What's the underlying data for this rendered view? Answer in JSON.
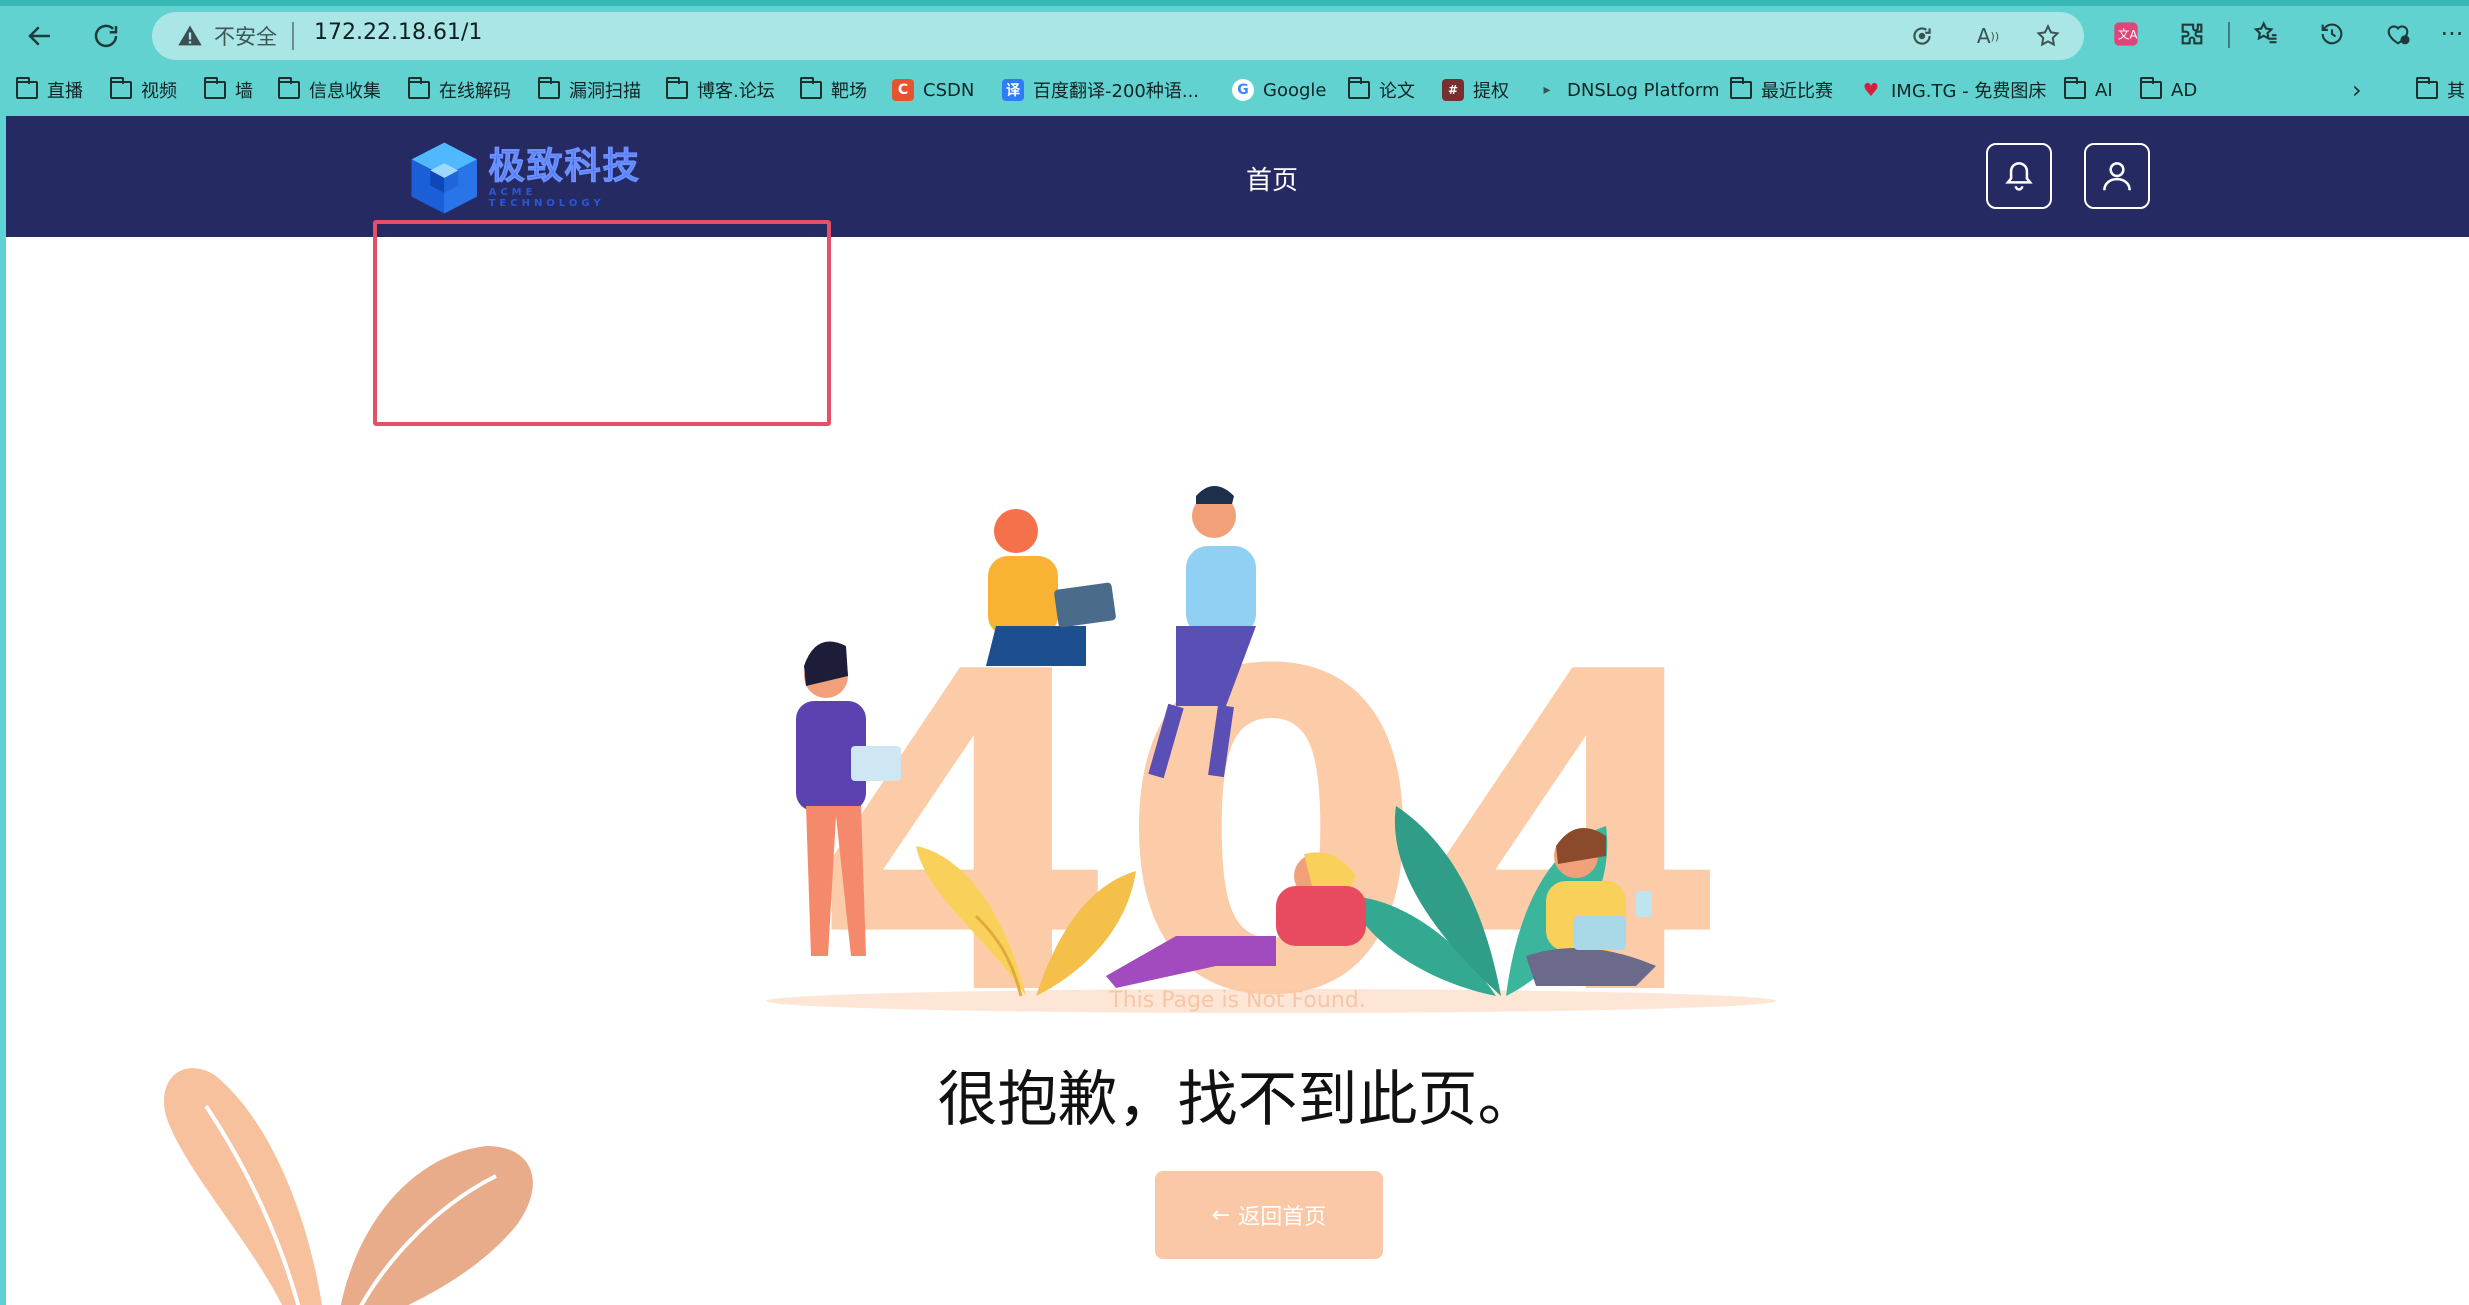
{
  "browser": {
    "security_label": "不安全",
    "url": "172.22.18.61/1",
    "bookmarks": [
      {
        "label": "直播",
        "icon": "folder-icon"
      },
      {
        "label": "视频",
        "icon": "folder-icon"
      },
      {
        "label": "墙",
        "icon": "folder-icon"
      },
      {
        "label": "信息收集",
        "icon": "folder-icon"
      },
      {
        "label": "在线解码",
        "icon": "folder-icon"
      },
      {
        "label": "漏洞扫描",
        "icon": "folder-icon"
      },
      {
        "label": "博客.论坛",
        "icon": "folder-icon"
      },
      {
        "label": "靶场",
        "icon": "folder-icon"
      },
      {
        "label": "CSDN",
        "icon": "csdn-icon"
      },
      {
        "label": "百度翻译-200种语...",
        "icon": "baidu-translate-icon"
      },
      {
        "label": "Google",
        "icon": "google-icon"
      },
      {
        "label": "论文",
        "icon": "folder-icon"
      },
      {
        "label": "提权",
        "icon": "grid-icon"
      },
      {
        "label": "DNSLog Platform",
        "icon": "dnslog-icon"
      },
      {
        "label": "最近比赛",
        "icon": "folder-icon"
      },
      {
        "label": "IMG.TG - 免费图床",
        "icon": "heart-icon"
      },
      {
        "label": "AI",
        "icon": "folder-icon"
      },
      {
        "label": "AD",
        "icon": "folder-icon"
      }
    ],
    "bookmarks_overflow_label": "其"
  },
  "site": {
    "logo_name": "极致科技",
    "logo_sub": "ACME TECHNOLOGY",
    "nav_home": "首页",
    "brand_color": "#262a62",
    "accent_color": "#fac8a6"
  },
  "error": {
    "en": "This Page is Not Found.",
    "cn": "很抱歉，找不到此页。",
    "back_button": "返回首页",
    "illustration_digits": "404"
  }
}
